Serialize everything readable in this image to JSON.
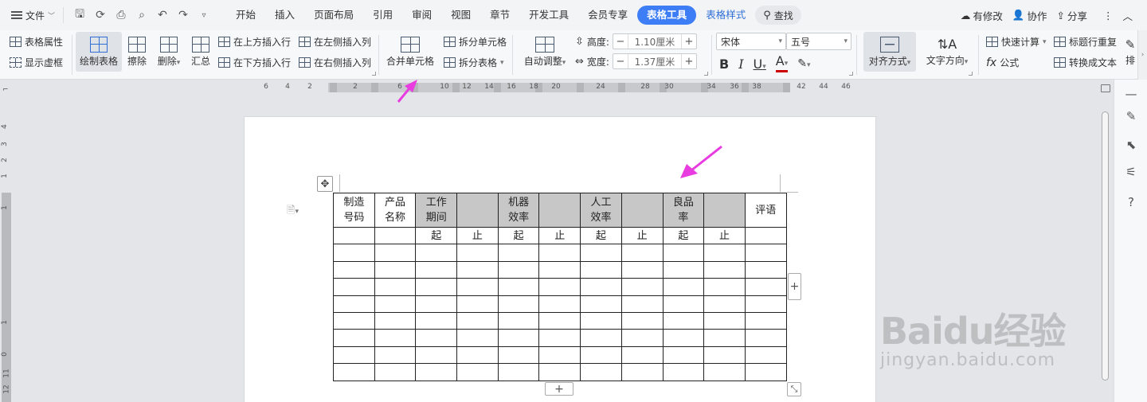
{
  "menubar": {
    "file_label": "文件",
    "tabs": [
      "开始",
      "插入",
      "页面布局",
      "引用",
      "审阅",
      "视图",
      "章节",
      "开发工具",
      "会员专享"
    ],
    "active_tool_tab": "表格工具",
    "style_tab": "表格样式",
    "search_label": "查找",
    "right": {
      "modified": "有修改",
      "collab": "协作",
      "share": "分享"
    }
  },
  "ribbon": {
    "table_props": "表格属性",
    "show_virtual": "显示虚框",
    "draw_table": "绘制表格",
    "erase": "擦除",
    "delete": "删除",
    "summary": "汇总",
    "insert_above": "在上方插入行",
    "insert_below": "在下方插入行",
    "insert_left": "在左侧插入列",
    "insert_right": "在右侧插入列",
    "merge_cells": "合并单元格",
    "split_cells": "拆分单元格",
    "split_table": "拆分表格",
    "auto_adjust": "自动调整",
    "height_label": "高度:",
    "height_value": "1.10厘米",
    "width_label": "宽度:",
    "width_value": "1.37厘米",
    "font_name": "宋体",
    "font_size": "五号",
    "align": "对齐方式",
    "text_dir": "文字方向",
    "quick_calc": "快速计算",
    "repeat_title": "标题行重复",
    "formula": "公式",
    "to_text": "转换成文本",
    "sort": "排"
  },
  "ruler": {
    "labels": [
      "6",
      "4",
      "2",
      "2",
      "6",
      "10",
      "12",
      "14",
      "16",
      "18",
      "20",
      "24",
      "28",
      "30",
      "34",
      "36",
      "38",
      "42",
      "44",
      "46"
    ]
  },
  "vruler": {
    "labels": [
      "4",
      "3",
      "2",
      "1",
      "1",
      "1",
      "0",
      "11",
      "12"
    ]
  },
  "table": {
    "header_row": [
      {
        "lines": [
          "制造",
          "号码"
        ],
        "shade": false
      },
      {
        "lines": [
          "产品",
          "名称"
        ],
        "shade": false
      },
      {
        "lines": [
          "工作",
          "期间"
        ],
        "shade": true
      },
      {
        "lines": [
          ""
        ],
        "shade": true
      },
      {
        "lines": [
          "机器",
          "效率"
        ],
        "shade": true
      },
      {
        "lines": [
          ""
        ],
        "shade": true
      },
      {
        "lines": [
          "人工",
          "效率"
        ],
        "shade": true
      },
      {
        "lines": [
          ""
        ],
        "shade": true
      },
      {
        "lines": [
          "良品",
          "率"
        ],
        "shade": true
      },
      {
        "lines": [
          ""
        ],
        "shade": true
      },
      {
        "lines": [
          "评语"
        ],
        "shade": false
      }
    ],
    "sub_row": [
      "",
      "",
      "起",
      "止",
      "起",
      "止",
      "起",
      "止",
      "起",
      "止",
      ""
    ],
    "empty_rows": 8,
    "columns": 11
  },
  "watermark": {
    "brand": "Baidu经验",
    "url": "jingyan.baidu.com"
  },
  "colors": {
    "accent": "#3d7ef6",
    "arrow": "#e83ce0",
    "shade": "#c7c7c7"
  }
}
